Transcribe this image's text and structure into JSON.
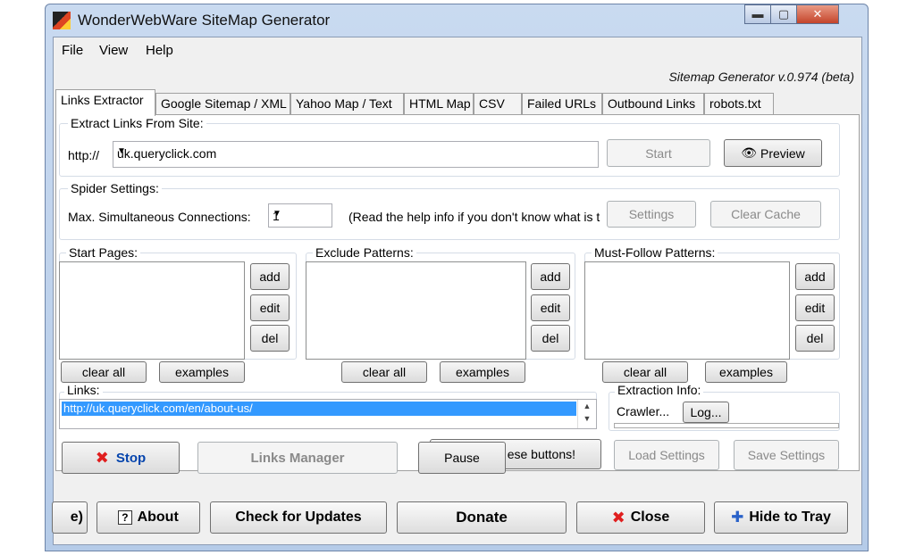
{
  "window": {
    "title": "WonderWebWare SiteMap Generator",
    "minimize": "▬",
    "maximize": "▢",
    "close": "✕"
  },
  "menu": [
    "File",
    "View",
    "Help"
  ],
  "version": "Sitemap Generator v.0.974 (beta)",
  "tabs": [
    "Links Extractor",
    "Google Sitemap / XML",
    "Yahoo Map / Text",
    "HTML Map",
    "CSV",
    "Failed URLs",
    "Outbound Links",
    "robots.txt"
  ],
  "extract": {
    "label": "Extract Links From Site:",
    "prefix": "http://",
    "url": "uk.queryclick.com",
    "start": "Start",
    "preview": "Preview"
  },
  "spider": {
    "label": "Spider Settings:",
    "conn_label": "Max. Simultaneous Connections:",
    "conn_value": "1",
    "help": "(Read the help info if you don't know what is t",
    "settings": "Settings",
    "clear_cache": "Clear Cache"
  },
  "lists": {
    "start": {
      "label": "Start Pages:"
    },
    "exclude": {
      "label": "Exclude Patterns:"
    },
    "must": {
      "label": "Must-Follow Patterns:"
    },
    "add": "add",
    "edit": "edit",
    "del": "del",
    "clear_all": "clear all",
    "examples": "examples"
  },
  "links": {
    "label": "Links:",
    "selected": "http://uk.queryclick.com/en/about-us/"
  },
  "extraction": {
    "label": "Extraction Info:",
    "crawler": "Crawler...",
    "log": "Log..."
  },
  "actions": {
    "stop": "Stop",
    "links_manager": "Links Manager",
    "pause": "Pause",
    "behind": "ese buttons!",
    "load": "Load Settings",
    "save": "Save Settings"
  },
  "bottom": {
    "partial": "e)",
    "about": "About",
    "updates": "Check for Updates",
    "donate": "Donate",
    "close": "Close",
    "tray": "Hide to Tray"
  },
  "colors": {
    "selection": "#3399ff",
    "stop_icon": "#e01e1e"
  }
}
